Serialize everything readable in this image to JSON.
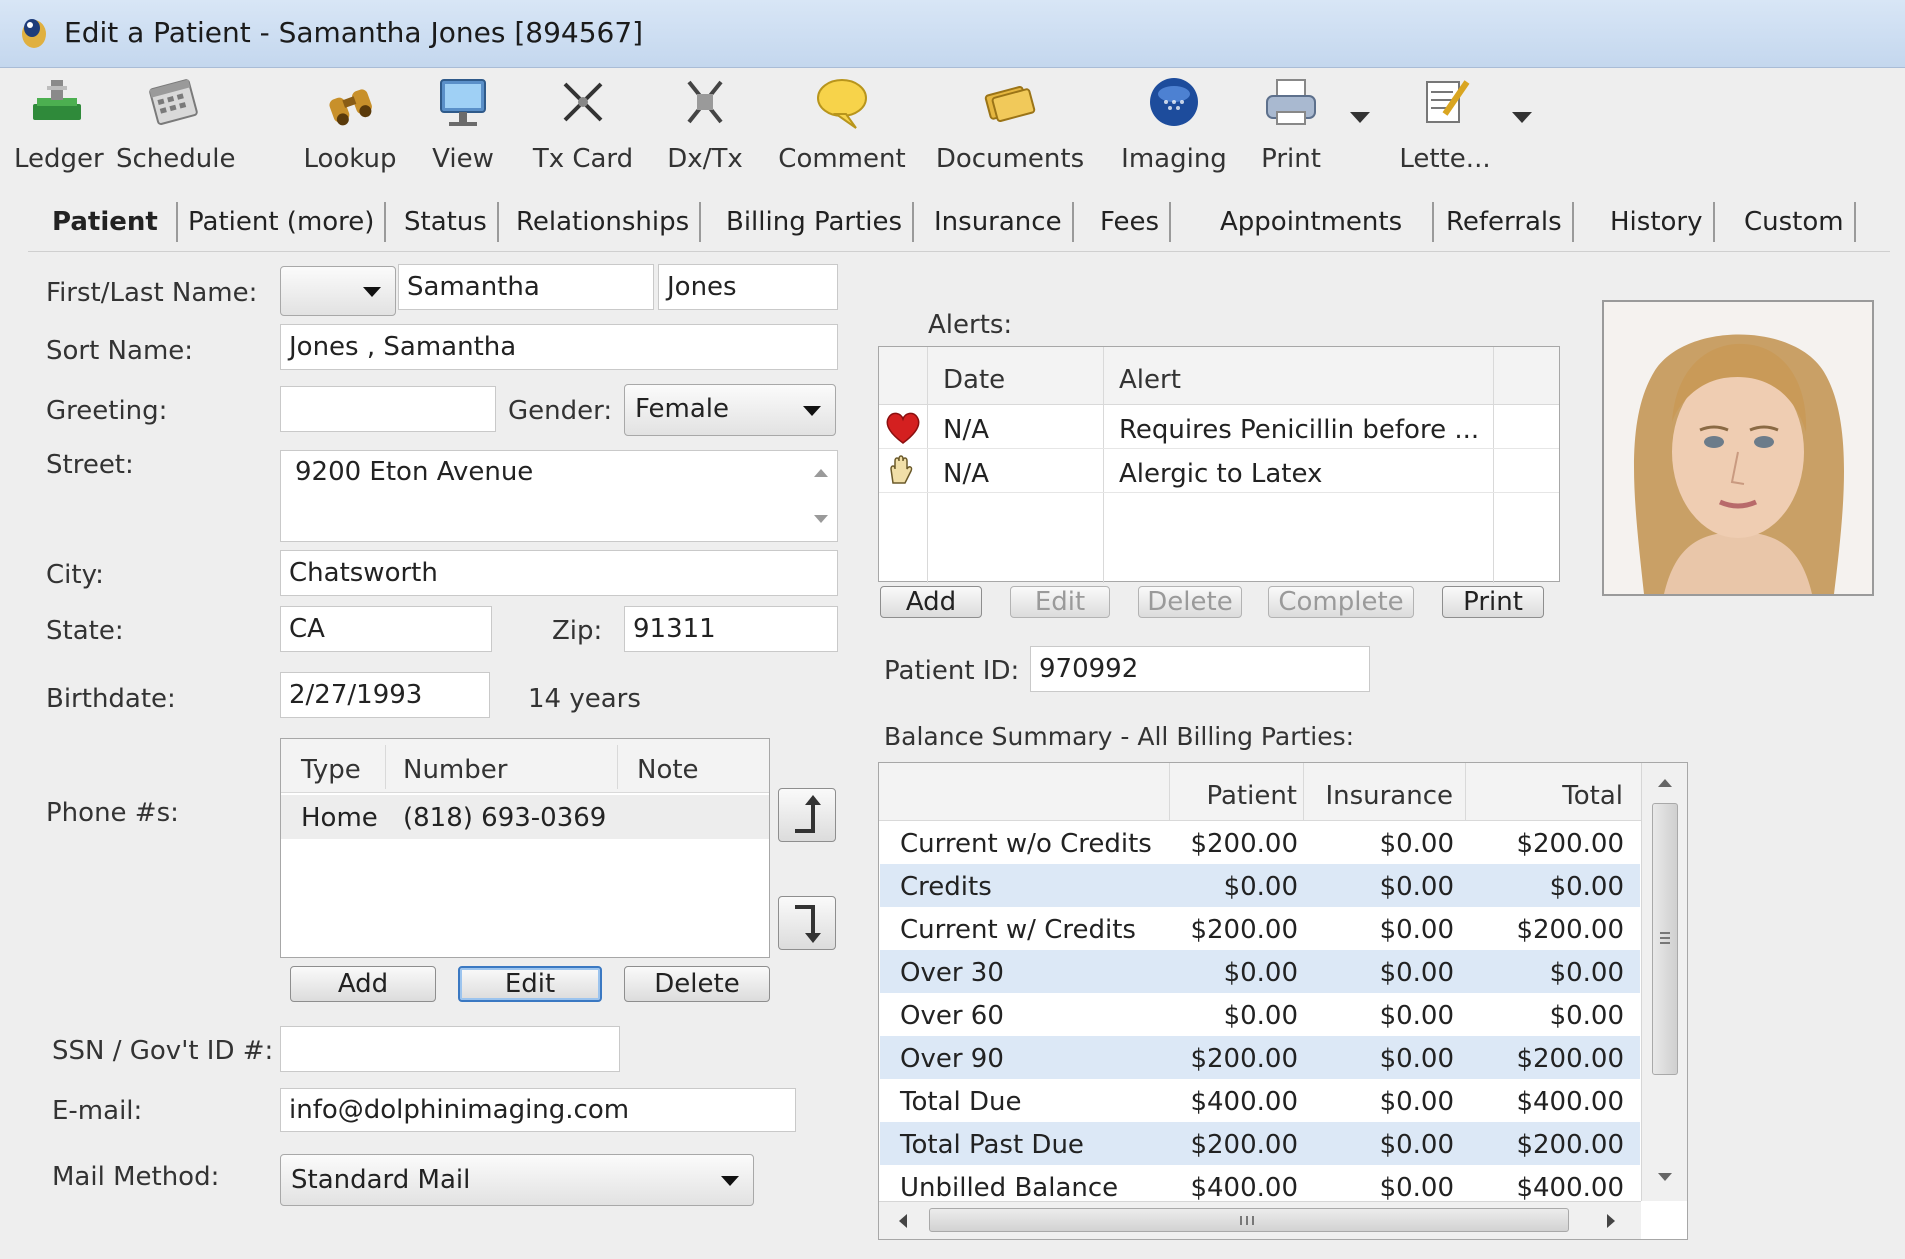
{
  "window": {
    "title": "Edit a Patient - Samantha Jones [894567]"
  },
  "toolbar": {
    "ledger": "Ledger",
    "schedule": "Schedule",
    "lookup": "Lookup",
    "view": "View",
    "tx_card": "Tx Card",
    "dx_tx": "Dx/Tx",
    "comment": "Comment",
    "documents": "Documents",
    "imaging": "Imaging",
    "print": "Print",
    "letters": "Lette..."
  },
  "tabs": [
    "Patient",
    "Patient (more)",
    "Status",
    "Relationships",
    "Billing Parties",
    "Insurance",
    "Fees",
    "Appointments",
    "Referrals",
    "History",
    "Custom"
  ],
  "form": {
    "first_last_label": "First/Last Name:",
    "title_value": "",
    "first_name": "Samantha",
    "last_name": "Jones",
    "sort_label": "Sort Name:",
    "sort_name": "Jones , Samantha",
    "greeting_label": "Greeting:",
    "greeting": "",
    "gender_label": "Gender:",
    "gender": "Female",
    "street_label": "Street:",
    "street": "9200 Eton Avenue",
    "city_label": "City:",
    "city": "Chatsworth",
    "state_label": "State:",
    "state": "CA",
    "zip_label": "Zip:",
    "zip": "91311",
    "birthdate_label": "Birthdate:",
    "birthdate": "2/27/1993",
    "age": "14 years",
    "phones_label": "Phone #s:",
    "ssn_label": "SSN / Gov't ID #:",
    "ssn": "",
    "email_label": "E-mail:",
    "email": "info@dolphinimaging.com",
    "mail_label": "Mail Method:",
    "mail_method": "Standard Mail"
  },
  "phones": {
    "headers": {
      "type": "Type",
      "number": "Number",
      "note": "Note"
    },
    "rows": [
      {
        "type": "Home",
        "number": "(818) 693-0369",
        "note": ""
      }
    ],
    "add": "Add",
    "edit": "Edit",
    "delete": "Delete"
  },
  "alerts": {
    "label": "Alerts:",
    "headers": {
      "date": "Date",
      "alert": "Alert"
    },
    "rows": [
      {
        "icon": "heart-icon",
        "date": "N/A",
        "alert": "Requires Penicillin before ..."
      },
      {
        "icon": "latex-glove-icon",
        "date": "N/A",
        "alert": "Alergic to Latex"
      }
    ],
    "add": "Add",
    "edit": "Edit",
    "delete": "Delete",
    "complete": "Complete",
    "print": "Print"
  },
  "patient_id": {
    "label": "Patient ID:",
    "value": "970992"
  },
  "balance": {
    "label": "Balance Summary - All Billing Parties:",
    "headers": {
      "patient": "Patient",
      "insurance": "Insurance",
      "total": "Total"
    },
    "rows": [
      {
        "name": "Current w/o Credits",
        "patient": "$200.00",
        "insurance": "$0.00",
        "total": "$200.00"
      },
      {
        "name": "Credits",
        "patient": "$0.00",
        "insurance": "$0.00",
        "total": "$0.00"
      },
      {
        "name": "Current w/ Credits",
        "patient": "$200.00",
        "insurance": "$0.00",
        "total": "$200.00"
      },
      {
        "name": "Over 30",
        "patient": "$0.00",
        "insurance": "$0.00",
        "total": "$0.00"
      },
      {
        "name": "Over 60",
        "patient": "$0.00",
        "insurance": "$0.00",
        "total": "$0.00"
      },
      {
        "name": "Over 90",
        "patient": "$200.00",
        "insurance": "$0.00",
        "total": "$200.00"
      },
      {
        "name": "Total Due",
        "patient": "$400.00",
        "insurance": "$0.00",
        "total": "$400.00"
      },
      {
        "name": "Total Past Due",
        "patient": "$200.00",
        "insurance": "$0.00",
        "total": "$200.00"
      },
      {
        "name": "Unbilled Balance",
        "patient": "$400.00",
        "insurance": "$0.00",
        "total": "$400.00"
      }
    ]
  },
  "colors": {
    "title_bar": "#c9dbef",
    "alt_row": "#dce8f6",
    "focus": "#3a78c2"
  }
}
